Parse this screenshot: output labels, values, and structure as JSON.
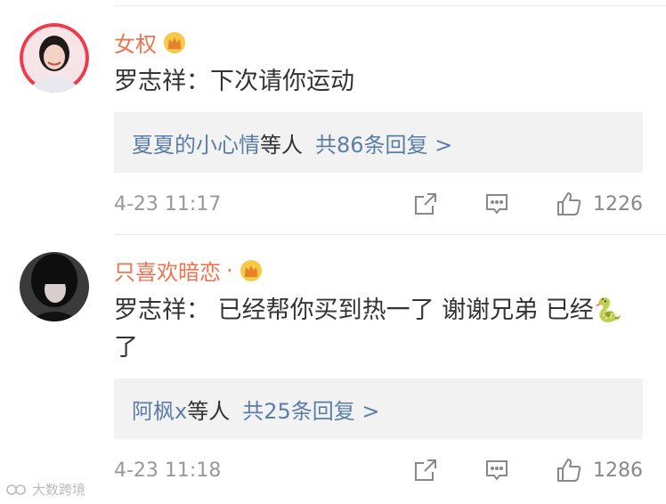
{
  "comments": [
    {
      "username": "女权",
      "name_dot": "",
      "text": "罗志祥：下次请你运动",
      "snake": "",
      "text_tail": "",
      "reply_users": "夏夏的小心情",
      "reply_suffix": "等人",
      "reply_total": "共86条回复 >",
      "time": "4-23 11:17",
      "likes": "1226"
    },
    {
      "username": "只喜欢暗恋",
      "name_dot": "·",
      "text": "罗志祥： 已经帮你买到热一了 谢谢兄弟 已经",
      "snake": "🐍",
      "text_tail": "了",
      "reply_users": "阿枫x",
      "reply_suffix": "等人",
      "reply_total": "共25条回复 >",
      "time": "4-23 11:18",
      "likes": "1286"
    }
  ],
  "watermark": "大数跨境",
  "colors": {
    "username": "#eb7350",
    "link": "#5a7ea8",
    "reply_bg": "#f2f2f2"
  }
}
